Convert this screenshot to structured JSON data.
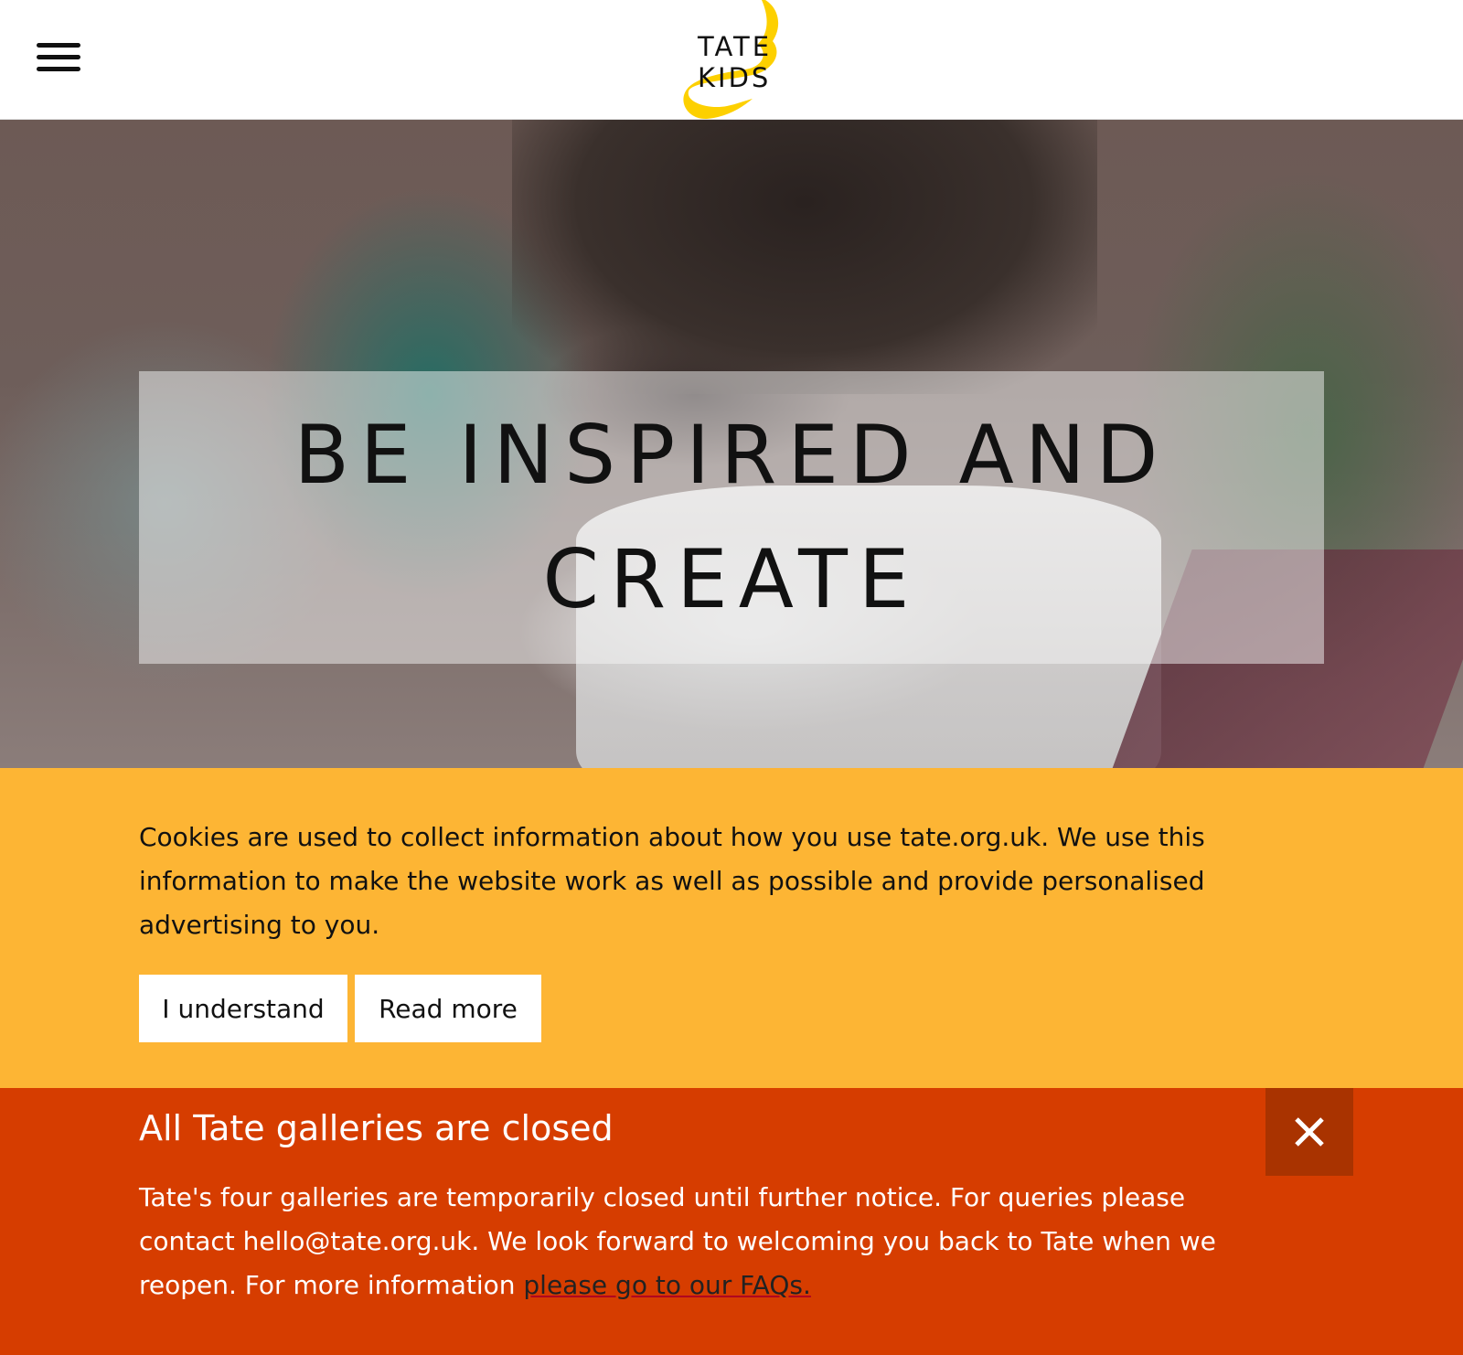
{
  "header": {
    "menu_icon": "hamburger-menu-icon",
    "logo_line1": "TATE",
    "logo_line2": "KIDS",
    "logo_color": "#fdd000"
  },
  "hero": {
    "title": "BE INSPIRED AND CREATE"
  },
  "cookie_banner": {
    "text": "Cookies are used to collect information about how you use tate.org.uk. We use this information to make the website work as well as possible and provide personalised advertising to you.",
    "understand_label": "I understand",
    "read_more_label": "Read more",
    "background": "#fdb534"
  },
  "alert": {
    "title": "All Tate galleries are closed",
    "body_text": "Tate's four galleries are temporarily closed until further notice. For queries please contact hello@tate.org.uk. We look forward to welcoming you back to Tate when we reopen. For more information ",
    "link_text": "please go to our FAQs.",
    "close_icon": "close-icon",
    "background": "#d63d00"
  }
}
